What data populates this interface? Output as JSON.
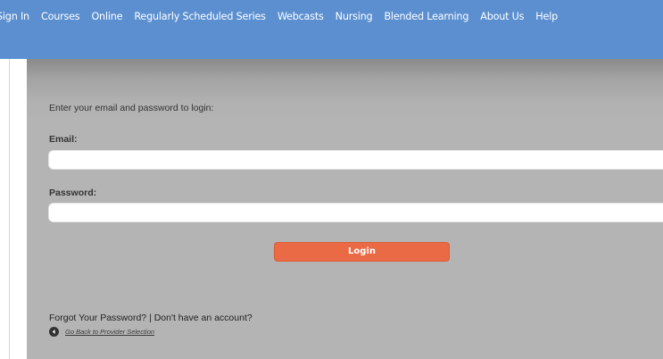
{
  "nav": {
    "items": [
      {
        "label": "Sign In"
      },
      {
        "label": "Courses"
      },
      {
        "label": "Online"
      },
      {
        "label": "Regularly Scheduled Series"
      },
      {
        "label": "Webcasts"
      },
      {
        "label": "Nursing"
      },
      {
        "label": "Blended Learning"
      },
      {
        "label": "About Us"
      },
      {
        "label": "Help"
      }
    ]
  },
  "login": {
    "intro": "Enter your email and password to login:",
    "email_label": "Email:",
    "email_value": "",
    "password_label": "Password:",
    "password_value": "",
    "submit_label": "Login"
  },
  "footer": {
    "help_text": "Forgot Your Password? | Don't have an account?",
    "back_link": "Go Back to Provider Selection",
    "back_icon": "arrow-left-circle-icon"
  },
  "colors": {
    "nav_bg": "#5b8fd0",
    "panel_bg": "#b4b4b4",
    "button_bg": "#e96a45"
  }
}
